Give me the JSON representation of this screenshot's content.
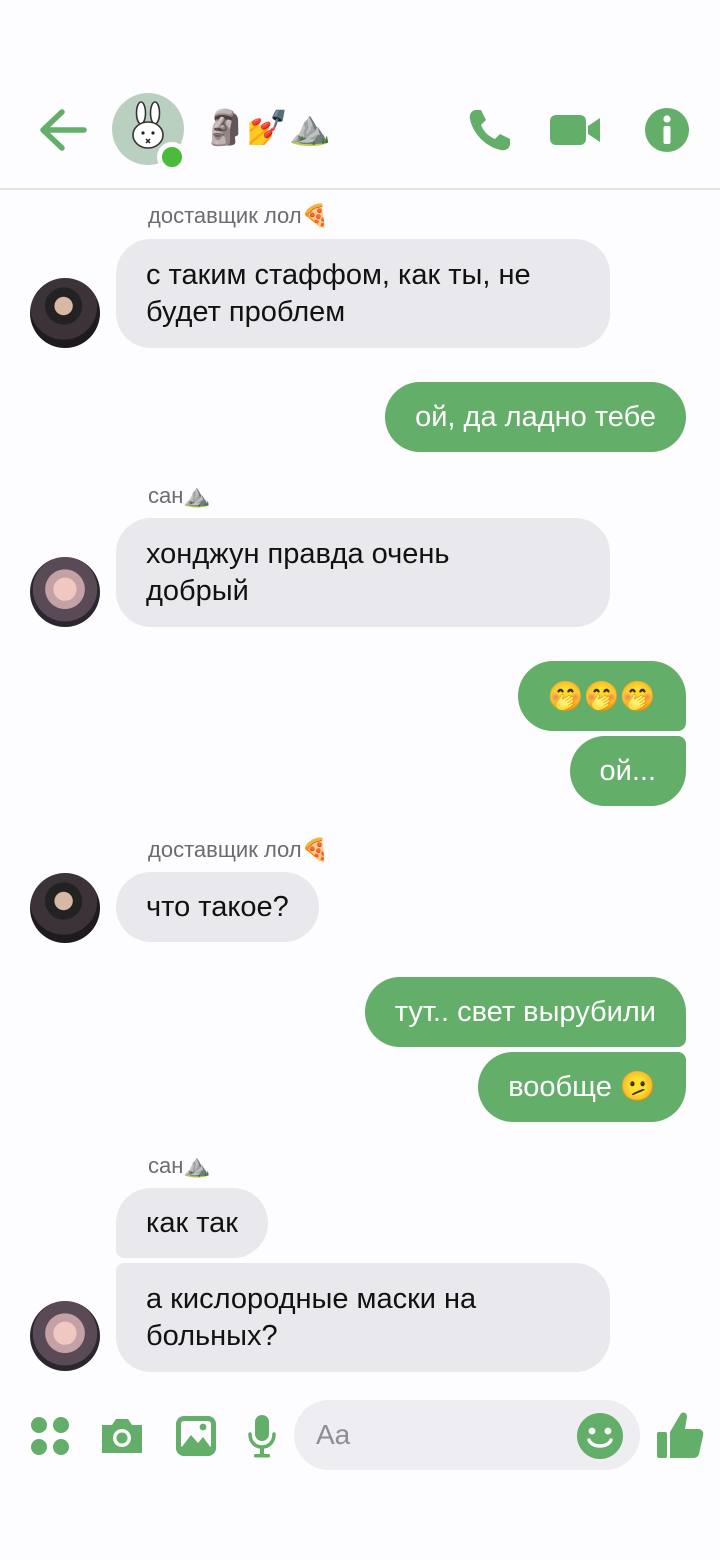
{
  "header": {
    "title": "🗿💅⛰️",
    "accent": "#63ae68",
    "icons": [
      "back-arrow-icon",
      "bunny-avatar-icon",
      "phone-icon",
      "video-camera-icon",
      "info-icon"
    ]
  },
  "messages": [
    {
      "side": "in",
      "sender": "доставщик лол🍕",
      "lines": [
        "с таким стаффом, как ты, не",
        "будет проблем"
      ]
    },
    {
      "side": "out",
      "lines": [
        "ой, да ладно тебе"
      ]
    },
    {
      "side": "in",
      "sender": "сан⛰️",
      "lines": [
        "хонджун правда очень",
        "добрый"
      ]
    },
    {
      "side": "out",
      "lines": [
        "🤭🤭🤭"
      ]
    },
    {
      "side": "out",
      "lines": [
        "ой..."
      ]
    },
    {
      "side": "in",
      "sender": "доставщик лол🍕",
      "lines": [
        "что такое?"
      ]
    },
    {
      "side": "out",
      "lines": [
        "тут.. свет вырубили"
      ]
    },
    {
      "side": "out",
      "lines": [
        "вообще 🫤"
      ]
    },
    {
      "side": "in",
      "sender": "сан⛰️",
      "lines": [
        "как так"
      ]
    },
    {
      "side": "in",
      "lines": [
        "а кислородные маски на",
        "больных?"
      ]
    }
  ],
  "composer": {
    "placeholder": "Aa",
    "icons": [
      "apps-grid-icon",
      "camera-icon",
      "gallery-icon",
      "microphone-icon",
      "emoji-icon",
      "thumbs-up-icon"
    ]
  }
}
